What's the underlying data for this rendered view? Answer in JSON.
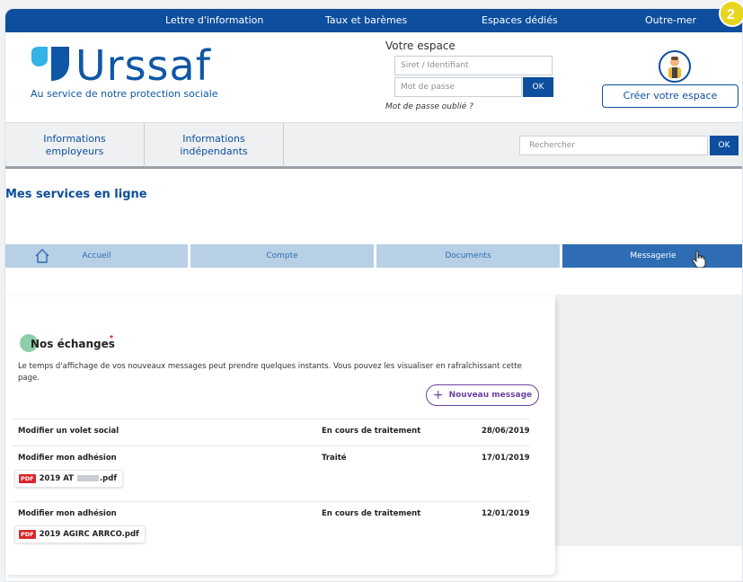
{
  "topnav": {
    "links": [
      "Lettre d'information",
      "Taux et barèmes",
      "Espaces dédiés",
      "Outre-mer"
    ],
    "step_badge": "2"
  },
  "header": {
    "logo_text": "Urssaf",
    "tagline": "Au service de notre protection sociale",
    "space_title": "Votre espace",
    "siret_placeholder": "Siret / Identifiant",
    "password_placeholder": "Mot de passe",
    "ok_label": "OK",
    "forgot_password": "Mot de passe oublié ?",
    "create_space_label": "Créer votre espace"
  },
  "subnav": {
    "items": [
      {
        "line1": "Informations",
        "line2": "employeurs"
      },
      {
        "line1": "Informations",
        "line2": "indépendants"
      }
    ],
    "search_placeholder": "Rechercher",
    "search_ok": "OK"
  },
  "services_title": "Mes services en ligne",
  "tabs": [
    {
      "label": "Accueil",
      "active": false
    },
    {
      "label": "Compte",
      "active": false
    },
    {
      "label": "Documents",
      "active": false
    },
    {
      "label": "Messagerie",
      "active": true
    }
  ],
  "exchanges": {
    "title": "Nos échanges",
    "required_mark": "*",
    "note": "Le temps d'affichage de vos nouveaux messages peut prendre quelques instants. Vous pouvez les visualiser en rafraîchissant cette page.",
    "new_message_label": "Nouveau message",
    "pdf_label": "PDF",
    "messages": [
      {
        "subject": "Modifier un volet social",
        "status": "En cours de traitement",
        "date": "28/06/2019"
      },
      {
        "subject": "Modifier mon adhésion",
        "status": "Traité",
        "date": "17/01/2019",
        "attachment_prefix": "2019 AT",
        "attachment_suffix": ".pdf"
      },
      {
        "subject": "Modifier mon adhésion",
        "status": "En cours de traitement",
        "date": "12/01/2019",
        "attachment": "2019 AGIRC ARRCO.pdf"
      }
    ]
  },
  "colors": {
    "brand_blue": "#0d4e9e",
    "tab_inactive": "#b8d0e6",
    "tab_active": "#2e6db3",
    "accent_purple": "#6b3fa0",
    "pdf_red": "#d9262c",
    "badge_yellow": "#e8d51e"
  }
}
